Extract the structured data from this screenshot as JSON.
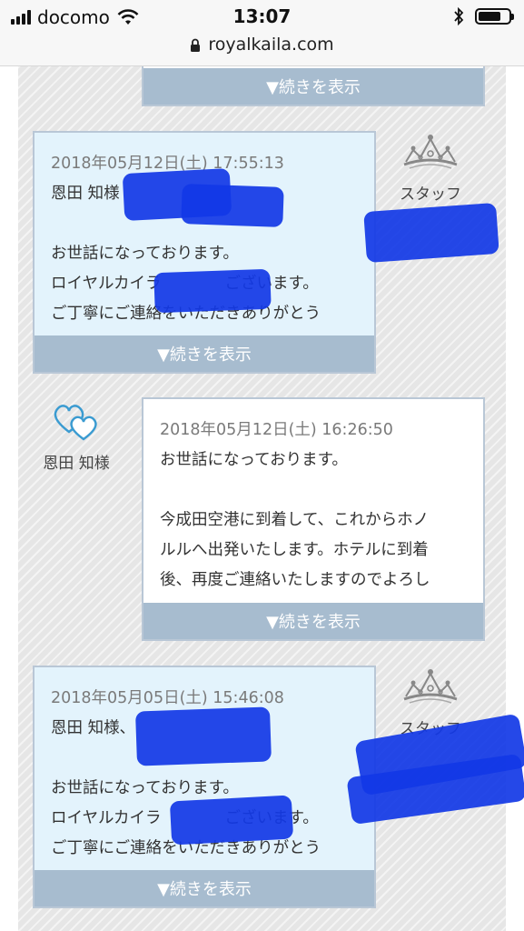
{
  "status_bar": {
    "carrier": "docomo",
    "time": "13:07",
    "url": "royalkaila.com",
    "battery_level": 0.75
  },
  "more_label": "▼続きを表示",
  "messages": [
    {
      "sender": "",
      "date": "",
      "lines": []
    },
    {
      "sender": "スタッフ",
      "date": "2018年05月12日(土) 17:55:13",
      "lines": [
        "恩田 知様",
        "",
        "お世話になっております。",
        "ロイヤルカイラ　　　　ございます。",
        "ご丁寧にご連絡をいただきありがとう"
      ]
    },
    {
      "sender": "恩田 知様",
      "date": "2018年05月12日(土) 16:26:50",
      "lines": [
        "お世話になっております。",
        "",
        "今成田空港に到着して、これからホノ",
        "ルルへ出発いたします。ホテルに到着",
        "後、再度ご連絡いたしますのでよろし"
      ]
    },
    {
      "sender": "スタッフ",
      "date": "2018年05月05日(土) 15:46:08",
      "lines": [
        "恩田 知様、",
        "",
        "お世話になっております。",
        "ロイヤルカイラ　　　　ございます。",
        "ご丁寧にご連絡をいただきありがとう"
      ]
    }
  ],
  "colors": {
    "staff_card_bg": "#e3f3fc",
    "more_bar_bg": "#a7bccf",
    "card_border": "#b9c7d6",
    "heart_color": "#3a9bd1",
    "redaction": "#1238e6"
  }
}
